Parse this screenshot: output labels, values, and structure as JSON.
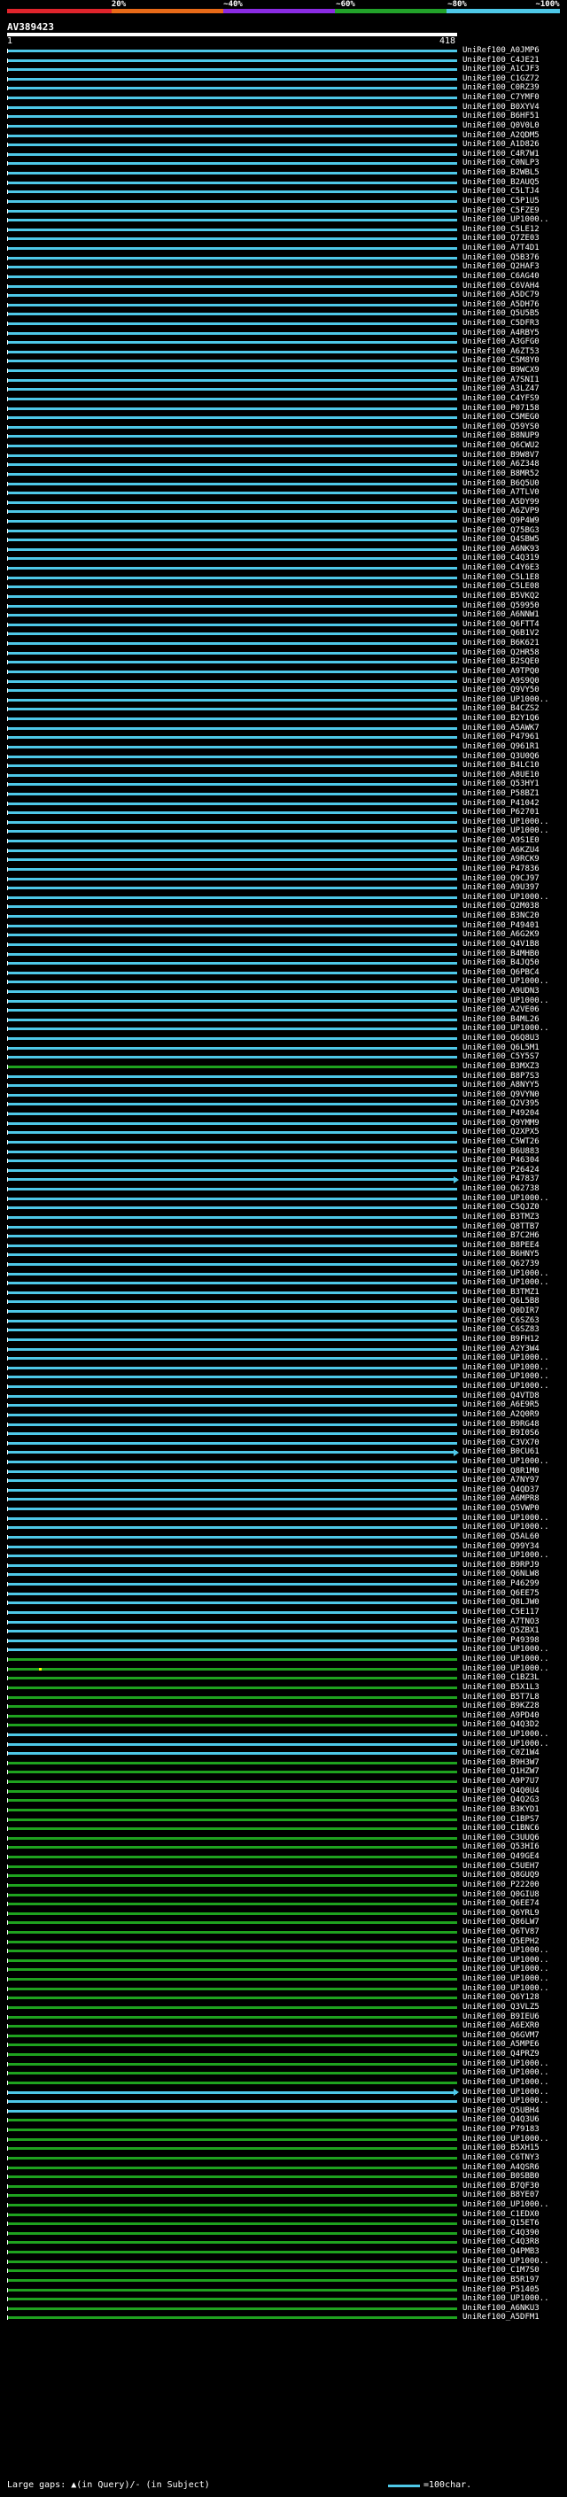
{
  "query": {
    "name": "AV389423",
    "start": "1",
    "end": "418"
  },
  "identity_scale": {
    "ticks": [
      "20%",
      "~40%",
      "~60%",
      "~80%",
      "~100%"
    ],
    "colors": [
      "#e0242c",
      "#e86a18",
      "#8a2be2",
      "#22a22a",
      "#4ec8e8"
    ]
  },
  "colors": {
    "cyan_hit": "#4ec8e8",
    "green_hit": "#1fa21f",
    "tick": "#ffffff"
  },
  "hits": [
    {
      "label": "UniRef100_A0JMP6",
      "color": "cyan"
    },
    {
      "label": "UniRef100_C4JE21",
      "color": "cyan"
    },
    {
      "label": "UniRef100_A1CJF3",
      "color": "cyan"
    },
    {
      "label": "UniRef100_C1GZ72",
      "color": "cyan"
    },
    {
      "label": "UniRef100_C0RZ39",
      "color": "cyan"
    },
    {
      "label": "UniRef100_C7YMF0",
      "color": "cyan"
    },
    {
      "label": "UniRef100_B0XYV4",
      "color": "cyan"
    },
    {
      "label": "UniRef100_B6HF51",
      "color": "cyan"
    },
    {
      "label": "UniRef100_Q0V0L0",
      "color": "cyan"
    },
    {
      "label": "UniRef100_A2QDM5",
      "color": "cyan"
    },
    {
      "label": "UniRef100_A1D826",
      "color": "cyan"
    },
    {
      "label": "UniRef100_C4R7W1",
      "color": "cyan"
    },
    {
      "label": "UniRef100_C0NLP3",
      "color": "cyan"
    },
    {
      "label": "UniRef100_B2WBL5",
      "color": "cyan"
    },
    {
      "label": "UniRef100_B2AUQ5",
      "color": "cyan"
    },
    {
      "label": "UniRef100_C5LTJ4",
      "color": "cyan"
    },
    {
      "label": "UniRef100_C5P1U5",
      "color": "cyan"
    },
    {
      "label": "UniRef100_C5FZE9",
      "color": "cyan"
    },
    {
      "label": "UniRef100_UP1000..",
      "color": "cyan"
    },
    {
      "label": "UniRef100_C5LE12",
      "color": "cyan"
    },
    {
      "label": "UniRef100_Q7ZE03",
      "color": "cyan"
    },
    {
      "label": "UniRef100_A7T4D1",
      "color": "cyan"
    },
    {
      "label": "UniRef100_Q5B376",
      "color": "cyan"
    },
    {
      "label": "UniRef100_Q2HAF3",
      "color": "cyan"
    },
    {
      "label": "UniRef100_C6AG40",
      "color": "cyan"
    },
    {
      "label": "UniRef100_C6VAH4",
      "color": "cyan"
    },
    {
      "label": "UniRef100_A5DC79",
      "color": "cyan"
    },
    {
      "label": "UniRef100_A5DH76",
      "color": "cyan"
    },
    {
      "label": "UniRef100_Q5U5B5",
      "color": "cyan"
    },
    {
      "label": "UniRef100_C5DFR3",
      "color": "cyan"
    },
    {
      "label": "UniRef100_A4RBY5",
      "color": "cyan"
    },
    {
      "label": "UniRef100_A3GFG0",
      "color": "cyan"
    },
    {
      "label": "UniRef100_A6ZT53",
      "color": "cyan"
    },
    {
      "label": "UniRef100_C5M8Y0",
      "color": "cyan"
    },
    {
      "label": "UniRef100_B9WCX9",
      "color": "cyan"
    },
    {
      "label": "UniRef100_A7SNI1",
      "color": "cyan"
    },
    {
      "label": "UniRef100_A3LZ47",
      "color": "cyan"
    },
    {
      "label": "UniRef100_C4YFS9",
      "color": "cyan"
    },
    {
      "label": "UniRef100_P07158",
      "color": "cyan"
    },
    {
      "label": "UniRef100_C5MEG0",
      "color": "cyan"
    },
    {
      "label": "UniRef100_Q59YS0",
      "color": "cyan"
    },
    {
      "label": "UniRef100_B8NUP9",
      "color": "cyan"
    },
    {
      "label": "UniRef100_Q6CWU2",
      "color": "cyan"
    },
    {
      "label": "UniRef100_B9W8V7",
      "color": "cyan"
    },
    {
      "label": "UniRef100_A6Z348",
      "color": "cyan"
    },
    {
      "label": "UniRef100_B8MR52",
      "color": "cyan"
    },
    {
      "label": "UniRef100_B6Q5U0",
      "color": "cyan"
    },
    {
      "label": "UniRef100_A7TLV0",
      "color": "cyan"
    },
    {
      "label": "UniRef100_A5DY99",
      "color": "cyan"
    },
    {
      "label": "UniRef100_A6ZVP9",
      "color": "cyan"
    },
    {
      "label": "UniRef100_Q9P4W9",
      "color": "cyan"
    },
    {
      "label": "UniRef100_Q75BG3",
      "color": "cyan"
    },
    {
      "label": "UniRef100_Q4SBW5",
      "color": "cyan"
    },
    {
      "label": "UniRef100_A6NK93",
      "color": "cyan"
    },
    {
      "label": "UniRef100_C4Q319",
      "color": "cyan"
    },
    {
      "label": "UniRef100_C4Y6E3",
      "color": "cyan"
    },
    {
      "label": "UniRef100_C5L1E8",
      "color": "cyan"
    },
    {
      "label": "UniRef100_C5LE08",
      "color": "cyan"
    },
    {
      "label": "UniRef100_B5VKQ2",
      "color": "cyan"
    },
    {
      "label": "UniRef100_Q59950",
      "color": "cyan"
    },
    {
      "label": "UniRef100_A6NNW1",
      "color": "cyan"
    },
    {
      "label": "UniRef100_Q6FTT4",
      "color": "cyan"
    },
    {
      "label": "UniRef100_Q6B1V2",
      "color": "cyan"
    },
    {
      "label": "UniRef100_B6K621",
      "color": "cyan"
    },
    {
      "label": "UniRef100_Q2HR58",
      "color": "cyan"
    },
    {
      "label": "UniRef100_B2SQE0",
      "color": "cyan"
    },
    {
      "label": "UniRef100_A9TPQ0",
      "color": "cyan"
    },
    {
      "label": "UniRef100_A9S9Q0",
      "color": "cyan"
    },
    {
      "label": "UniRef100_Q9VY50",
      "color": "cyan"
    },
    {
      "label": "UniRef100_UP1000..",
      "color": "cyan"
    },
    {
      "label": "UniRef100_B4CZS2",
      "color": "cyan"
    },
    {
      "label": "UniRef100_B2Y1Q6",
      "color": "cyan"
    },
    {
      "label": "UniRef100_A5AWK7",
      "color": "cyan"
    },
    {
      "label": "UniRef100_P47961",
      "color": "cyan"
    },
    {
      "label": "UniRef100_Q961R1",
      "color": "cyan"
    },
    {
      "label": "UniRef100_Q3U0Q6",
      "color": "cyan"
    },
    {
      "label": "UniRef100_B4LC10",
      "color": "cyan"
    },
    {
      "label": "UniRef100_A8UE10",
      "color": "cyan"
    },
    {
      "label": "UniRef100_Q53HY1",
      "color": "cyan"
    },
    {
      "label": "UniRef100_P58BZ1",
      "color": "cyan"
    },
    {
      "label": "UniRef100_P41042",
      "color": "cyan"
    },
    {
      "label": "UniRef100_P62701",
      "color": "cyan"
    },
    {
      "label": "UniRef100_UP1000..",
      "color": "cyan"
    },
    {
      "label": "UniRef100_UP1000..",
      "color": "cyan"
    },
    {
      "label": "UniRef100_A9S1E0",
      "color": "cyan"
    },
    {
      "label": "UniRef100_A6KZU4",
      "color": "cyan"
    },
    {
      "label": "UniRef100_A9RCK9",
      "color": "cyan"
    },
    {
      "label": "UniRef100_P47836",
      "color": "cyan"
    },
    {
      "label": "UniRef100_Q9CJ97",
      "color": "cyan"
    },
    {
      "label": "UniRef100_A9U397",
      "color": "cyan"
    },
    {
      "label": "UniRef100_UP1000..",
      "color": "cyan"
    },
    {
      "label": "UniRef100_Q2M038",
      "color": "cyan"
    },
    {
      "label": "UniRef100_B3NC20",
      "color": "cyan"
    },
    {
      "label": "UniRef100_P49401",
      "color": "cyan"
    },
    {
      "label": "UniRef100_A6G2K9",
      "color": "cyan"
    },
    {
      "label": "UniRef100_Q4V1B8",
      "color": "cyan"
    },
    {
      "label": "UniRef100_B4MHB0",
      "color": "cyan"
    },
    {
      "label": "UniRef100_B4JQ50",
      "color": "cyan"
    },
    {
      "label": "UniRef100_Q6PBC4",
      "color": "cyan"
    },
    {
      "label": "UniRef100_UP1000..",
      "color": "cyan"
    },
    {
      "label": "UniRef100_A9UDN3",
      "color": "cyan"
    },
    {
      "label": "UniRef100_UP1000..",
      "color": "cyan"
    },
    {
      "label": "UniRef100_A2VE06",
      "color": "cyan"
    },
    {
      "label": "UniRef100_B4ML26",
      "color": "cyan"
    },
    {
      "label": "UniRef100_UP1000..",
      "color": "cyan"
    },
    {
      "label": "UniRef100_Q6Q8U3",
      "color": "cyan"
    },
    {
      "label": "UniRef100_Q6L5M1",
      "color": "cyan"
    },
    {
      "label": "UniRef100_C5Y5S7",
      "color": "cyan"
    },
    {
      "label": "UniRef100_B3MXZ3",
      "color": "green"
    },
    {
      "label": "UniRef100_B8P7S3",
      "color": "cyan"
    },
    {
      "label": "UniRef100_A8NYY5",
      "color": "cyan"
    },
    {
      "label": "UniRef100_Q9VYN0",
      "color": "cyan"
    },
    {
      "label": "UniRef100_Q2V395",
      "color": "cyan"
    },
    {
      "label": "UniRef100_P49204",
      "color": "cyan"
    },
    {
      "label": "UniRef100_Q9YMM9",
      "color": "cyan"
    },
    {
      "label": "UniRef100_Q2XPX5",
      "color": "cyan"
    },
    {
      "label": "UniRef100_C5WT26",
      "color": "cyan"
    },
    {
      "label": "UniRef100_B6U883",
      "color": "cyan"
    },
    {
      "label": "UniRef100_P46304",
      "color": "cyan"
    },
    {
      "label": "UniRef100_P26424",
      "color": "cyan"
    },
    {
      "label": "UniRef100_P47837",
      "color": "cyan",
      "arrow": true
    },
    {
      "label": "UniRef100_Q62738",
      "color": "cyan"
    },
    {
      "label": "UniRef100_UP1000..",
      "color": "cyan"
    },
    {
      "label": "UniRef100_C5QJZ0",
      "color": "cyan"
    },
    {
      "label": "UniRef100_B3TMZ3",
      "color": "cyan"
    },
    {
      "label": "UniRef100_Q8TTB7",
      "color": "cyan"
    },
    {
      "label": "UniRef100_B7C2H6",
      "color": "cyan"
    },
    {
      "label": "UniRef100_B8PEE4",
      "color": "cyan"
    },
    {
      "label": "UniRef100_B6HNY5",
      "color": "cyan"
    },
    {
      "label": "UniRef100_Q62739",
      "color": "cyan"
    },
    {
      "label": "UniRef100_UP1000..",
      "color": "cyan"
    },
    {
      "label": "UniRef100_UP1000..",
      "color": "cyan"
    },
    {
      "label": "UniRef100_B3TMZ1",
      "color": "cyan"
    },
    {
      "label": "UniRef100_Q6L5B8",
      "color": "cyan"
    },
    {
      "label": "UniRef100_Q0DIR7",
      "color": "cyan"
    },
    {
      "label": "UniRef100_C6SZ63",
      "color": "cyan"
    },
    {
      "label": "UniRef100_C6SZ83",
      "color": "cyan"
    },
    {
      "label": "UniRef100_B9FH12",
      "color": "cyan"
    },
    {
      "label": "UniRef100_A2Y3W4",
      "color": "cyan"
    },
    {
      "label": "UniRef100_UP1000..",
      "color": "cyan"
    },
    {
      "label": "UniRef100_UP1000..",
      "color": "cyan"
    },
    {
      "label": "UniRef100_UP1000..",
      "color": "cyan"
    },
    {
      "label": "UniRef100_UP1000..",
      "color": "cyan"
    },
    {
      "label": "UniRef100_Q4VTD8",
      "color": "cyan"
    },
    {
      "label": "UniRef100_A6E9R5",
      "color": "cyan"
    },
    {
      "label": "UniRef100_A2Q0R9",
      "color": "cyan"
    },
    {
      "label": "UniRef100_B9RG48",
      "color": "cyan"
    },
    {
      "label": "UniRef100_B9I0S6",
      "color": "cyan"
    },
    {
      "label": "UniRef100_C3VX70",
      "color": "cyan"
    },
    {
      "label": "UniRef100_B0CU61",
      "color": "cyan",
      "arrow": true
    },
    {
      "label": "UniRef100_UP1000..",
      "color": "cyan"
    },
    {
      "label": "UniRef100_Q8R1M0",
      "color": "cyan"
    },
    {
      "label": "UniRef100_A7NY97",
      "color": "cyan"
    },
    {
      "label": "UniRef100_Q4QD37",
      "color": "cyan"
    },
    {
      "label": "UniRef100_A6MPR8",
      "color": "cyan"
    },
    {
      "label": "UniRef100_Q5VWP0",
      "color": "cyan"
    },
    {
      "label": "UniRef100_UP1000..",
      "color": "cyan"
    },
    {
      "label": "UniRef100_UP1000..",
      "color": "cyan"
    },
    {
      "label": "UniRef100_Q5AL60",
      "color": "cyan"
    },
    {
      "label": "UniRef100_Q99Y34",
      "color": "cyan"
    },
    {
      "label": "UniRef100_UP1000..",
      "color": "cyan"
    },
    {
      "label": "UniRef100_B9RPJ9",
      "color": "cyan"
    },
    {
      "label": "UniRef100_Q6NLW8",
      "color": "cyan"
    },
    {
      "label": "UniRef100_P46299",
      "color": "cyan"
    },
    {
      "label": "UniRef100_Q6EE75",
      "color": "cyan"
    },
    {
      "label": "UniRef100_Q8LJW0",
      "color": "cyan"
    },
    {
      "label": "UniRef100_C5E117",
      "color": "cyan"
    },
    {
      "label": "UniRef100_A7TNO3",
      "color": "cyan"
    },
    {
      "label": "UniRef100_Q5ZBX1",
      "color": "cyan"
    },
    {
      "label": "UniRef100_P49398",
      "color": "cyan"
    },
    {
      "label": "UniRef100_UP1000..",
      "color": "cyan"
    },
    {
      "label": "UniRef100_UP1000..",
      "color": "green"
    },
    {
      "label": "UniRef100_UP1000..",
      "color": "green",
      "dot": true
    },
    {
      "label": "UniRef100_C1BZ3L",
      "color": "green"
    },
    {
      "label": "UniRef100_B5X1L3",
      "color": "green"
    },
    {
      "label": "UniRef100_B5T7L8",
      "color": "green"
    },
    {
      "label": "UniRef100_B9KZ28",
      "color": "green"
    },
    {
      "label": "UniRef100_A9PD40",
      "color": "green"
    },
    {
      "label": "UniRef100_Q4Q3D2",
      "color": "green"
    },
    {
      "label": "UniRef100_UP1000..",
      "color": "cyan"
    },
    {
      "label": "UniRef100_UP1000..",
      "color": "cyan"
    },
    {
      "label": "UniRef100_C0Z1W4",
      "color": "cyan"
    },
    {
      "label": "UniRef100_B9H3W7",
      "color": "green"
    },
    {
      "label": "UniRef100_Q1HZW7",
      "color": "green"
    },
    {
      "label": "UniRef100_A9P7U7",
      "color": "green"
    },
    {
      "label": "UniRef100_Q4Q0U4",
      "color": "green"
    },
    {
      "label": "UniRef100_Q4Q2G3",
      "color": "green"
    },
    {
      "label": "UniRef100_B3KYD1",
      "color": "green"
    },
    {
      "label": "UniRef100_C1BPS7",
      "color": "green"
    },
    {
      "label": "UniRef100_C1BNC6",
      "color": "green"
    },
    {
      "label": "UniRef100_C3UUQ6",
      "color": "green"
    },
    {
      "label": "UniRef100_Q53HI6",
      "color": "green"
    },
    {
      "label": "UniRef100_Q49GE4",
      "color": "green"
    },
    {
      "label": "UniRef100_C5UEH7",
      "color": "green"
    },
    {
      "label": "UniRef100_Q8GUQ9",
      "color": "green"
    },
    {
      "label": "UniRef100_P22200",
      "color": "green"
    },
    {
      "label": "UniRef100_Q0GIU8",
      "color": "green"
    },
    {
      "label": "UniRef100_Q6EE74",
      "color": "green"
    },
    {
      "label": "UniRef100_Q6YRL9",
      "color": "green"
    },
    {
      "label": "UniRef100_Q86LW7",
      "color": "green"
    },
    {
      "label": "UniRef100_Q6TV87",
      "color": "green"
    },
    {
      "label": "UniRef100_Q5EPH2",
      "color": "green"
    },
    {
      "label": "UniRef100_UP1000..",
      "color": "green"
    },
    {
      "label": "UniRef100_UP1000..",
      "color": "green"
    },
    {
      "label": "UniRef100_UP1000..",
      "color": "green"
    },
    {
      "label": "UniRef100_UP1000..",
      "color": "green"
    },
    {
      "label": "UniRef100_UP1000..",
      "color": "green"
    },
    {
      "label": "UniRef100_Q6Y128",
      "color": "green"
    },
    {
      "label": "UniRef100_Q3VLZ5",
      "color": "green"
    },
    {
      "label": "UniRef100_B9IEU6",
      "color": "green"
    },
    {
      "label": "UniRef100_A6EXR0",
      "color": "green"
    },
    {
      "label": "UniRef100_Q6GVM7",
      "color": "green"
    },
    {
      "label": "UniRef100_A5MPE6",
      "color": "green"
    },
    {
      "label": "UniRef100_Q4PRZ9",
      "color": "green"
    },
    {
      "label": "UniRef100_UP1000..",
      "color": "green"
    },
    {
      "label": "UniRef100_UP1000..",
      "color": "green"
    },
    {
      "label": "UniRef100_UP1000..",
      "color": "green"
    },
    {
      "label": "UniRef100_UP1000..",
      "color": "cyan",
      "arrow": true
    },
    {
      "label": "UniRef100_UP1000..",
      "color": "cyan"
    },
    {
      "label": "UniRef100_Q5UBH4",
      "color": "cyan"
    },
    {
      "label": "UniRef100_Q4Q3U6",
      "color": "green"
    },
    {
      "label": "UniRef100_P79183",
      "color": "green"
    },
    {
      "label": "UniRef100_UP1000..",
      "color": "green"
    },
    {
      "label": "UniRef100_B5XH15",
      "color": "green"
    },
    {
      "label": "UniRef100_C6TNY3",
      "color": "green"
    },
    {
      "label": "UniRef100_A4QSR6",
      "color": "green"
    },
    {
      "label": "UniRef100_B0SBB0",
      "color": "green"
    },
    {
      "label": "UniRef100_B7QF30",
      "color": "green"
    },
    {
      "label": "UniRef100_B8YE07",
      "color": "green"
    },
    {
      "label": "UniRef100_UP1000..",
      "color": "green"
    },
    {
      "label": "UniRef100_C1EDX0",
      "color": "green"
    },
    {
      "label": "UniRef100_Q15ET6",
      "color": "green"
    },
    {
      "label": "UniRef100_C4Q390",
      "color": "green"
    },
    {
      "label": "UniRef100_C4Q3R8",
      "color": "green"
    },
    {
      "label": "UniRef100_Q4PMB3",
      "color": "green"
    },
    {
      "label": "UniRef100_UP1000..",
      "color": "green"
    },
    {
      "label": "UniRef100_C1M7S0",
      "color": "green"
    },
    {
      "label": "UniRef100_B5R197",
      "color": "green"
    },
    {
      "label": "UniRef100_P51405",
      "color": "green"
    },
    {
      "label": "UniRef100_UP1000..",
      "color": "green"
    },
    {
      "label": "UniRef100_A6NKU3",
      "color": "green"
    },
    {
      "label": "UniRef100_A5DFM1",
      "color": "green"
    }
  ],
  "legend": {
    "gaps": "Large gaps: ▲(in Query)/- (in Subject)",
    "scale": "=100char."
  }
}
